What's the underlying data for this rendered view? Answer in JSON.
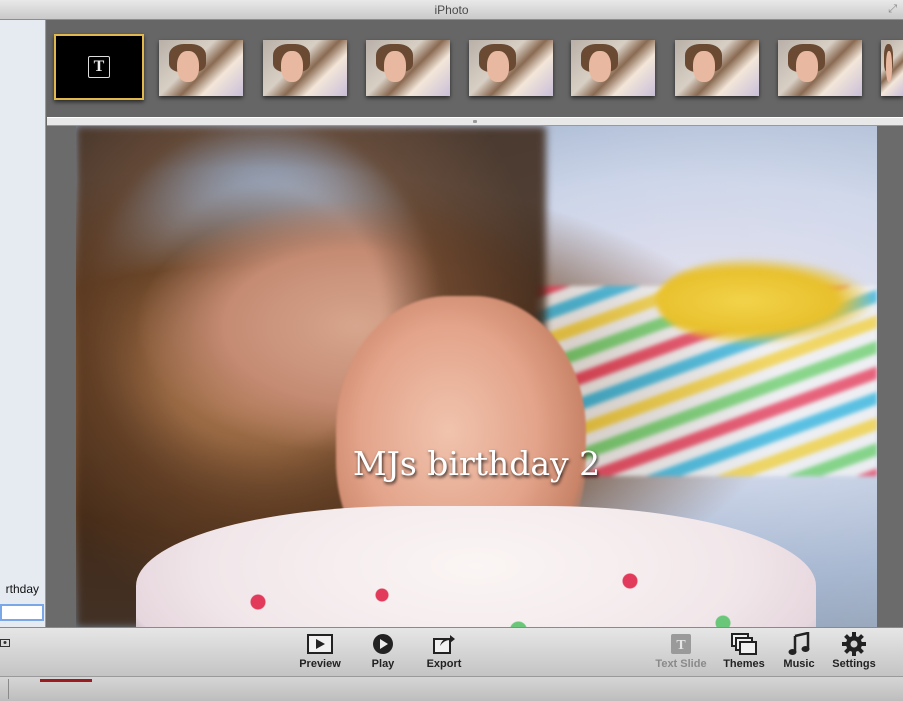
{
  "window": {
    "title": "iPhoto"
  },
  "sidebar": {
    "visible_label": "rthday",
    "field_value": ""
  },
  "strip": {
    "text_slide_glyph": "T",
    "thumbnail_count": 9
  },
  "slide": {
    "caption": "MJs birthday 2"
  },
  "toolbar": {
    "preview": "Preview",
    "play": "Play",
    "export": "Export",
    "text_slide": "Text Slide",
    "themes": "Themes",
    "music": "Music",
    "settings": "Settings"
  },
  "colors": {
    "selected_border": "#e0b84e",
    "progress": "#9b1b20"
  }
}
